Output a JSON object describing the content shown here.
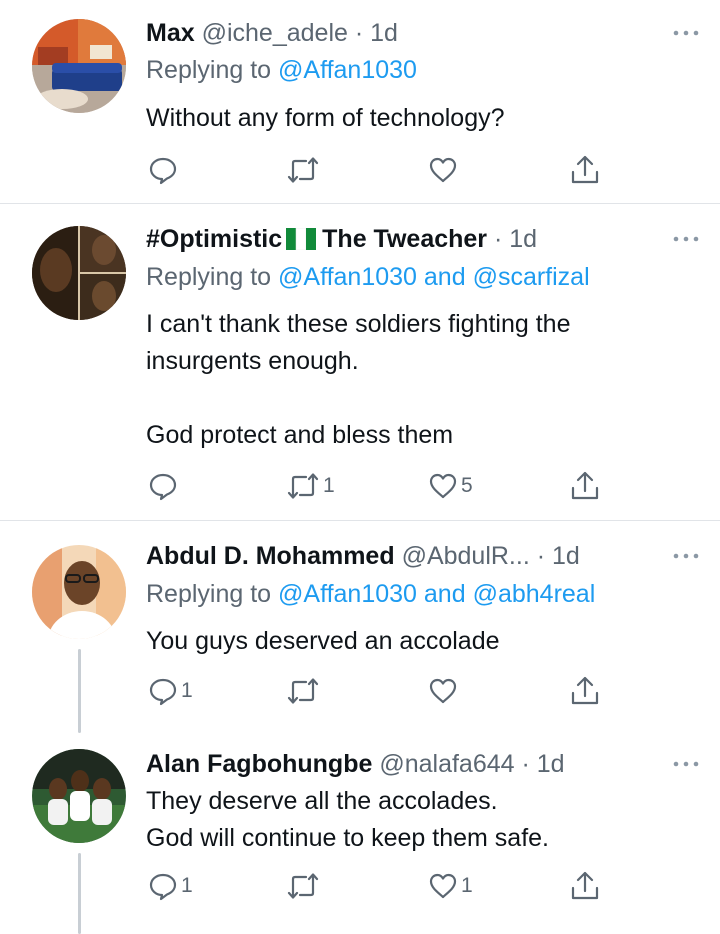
{
  "tweets": [
    {
      "name": "Max",
      "handle": "@iche_adele",
      "dot": "·",
      "time": "1d",
      "replying_prefix": "Replying to",
      "mentions": [
        "@Affan1030"
      ],
      "mention_joiner": "",
      "text": "Without any form of technology?",
      "reply_count": "",
      "retweet_count": "",
      "like_count": "",
      "avatar": "avatar-room-photo"
    },
    {
      "name_part1": "#Optimistic",
      "name_part2": "The Tweacher",
      "flag": "nigeria-flag-icon",
      "dot": "·",
      "time": "1d",
      "replying_prefix": "Replying to",
      "mentions": [
        "@Affan1030",
        "@scarfizal"
      ],
      "mention_joiner": "and",
      "text": "I can't thank these soldiers fighting the\ninsurgents enough.\n\nGod protect and bless them",
      "reply_count": "",
      "retweet_count": "1",
      "like_count": "5",
      "avatar": "avatar-collage-photo"
    },
    {
      "name": "Abdul D. Mohammed",
      "handle": "@AbdulR...",
      "dot": "·",
      "time": "1d",
      "replying_prefix": "Replying to",
      "mentions": [
        "@Affan1030",
        "@abh4real"
      ],
      "mention_joiner": "and",
      "text": "You guys deserved an accolade",
      "reply_count": "1",
      "retweet_count": "",
      "like_count": "",
      "avatar": "avatar-man-glasses-photo"
    },
    {
      "name": "Alan Fagbohungbe",
      "handle": "@nalafa644",
      "dot": "·",
      "time": "1d",
      "text": "They deserve all the accolades.\nGod will continue to keep them safe.",
      "reply_count": "1",
      "retweet_count": "",
      "like_count": "1",
      "avatar": "avatar-children-photo"
    }
  ],
  "icons": {
    "reply": "reply-icon",
    "retweet": "retweet-icon",
    "like": "heart-icon",
    "share": "share-icon",
    "more": "more-icon"
  },
  "colors": {
    "link": "#1d9bf0",
    "muted": "#5b6671",
    "text": "#0f1419",
    "divider": "#e1e4e8"
  }
}
